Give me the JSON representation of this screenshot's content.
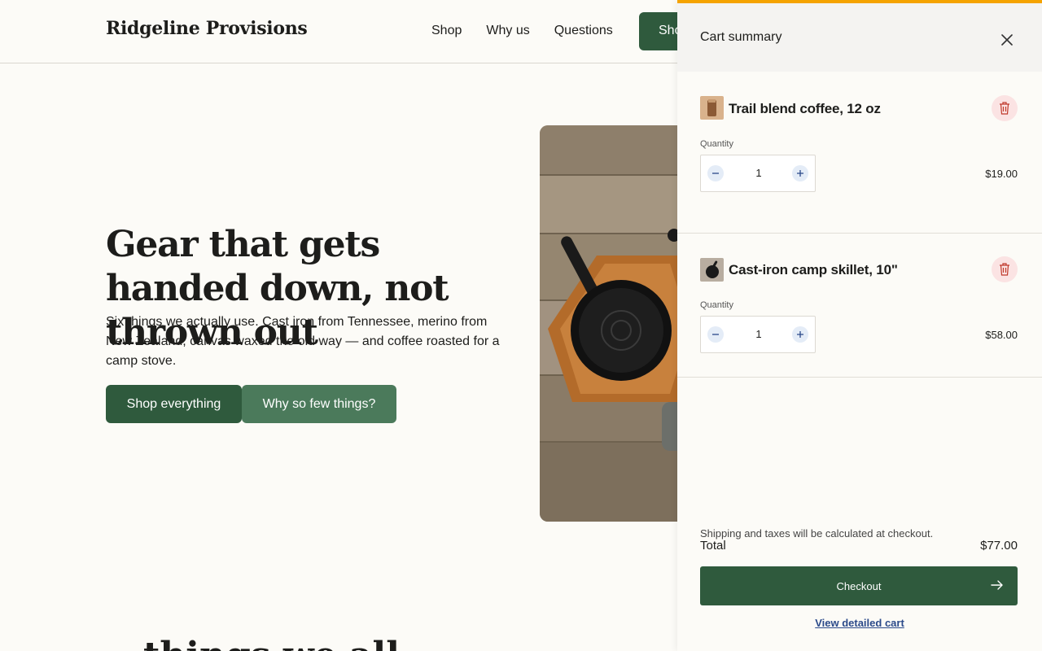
{
  "header": {
    "brand": "Ridgeline Provisions",
    "nav": [
      "Shop",
      "Why us",
      "Questions"
    ],
    "cta_label": "Shop"
  },
  "hero": {
    "title": "Gear that gets handed down, not thrown out",
    "subtitle": "Six things we actually use. Cast iron from Tennessee, merino from New Zealand, canvas waxed the old way — and coffee roasted for a camp stove.",
    "primary_button": "Shop everything",
    "secondary_button": "Why so few things?"
  },
  "next_section_peek": "...things we all...",
  "cart": {
    "title": "Cart summary",
    "quantity_label": "Quantity",
    "items": [
      {
        "name": "Trail blend coffee, 12 oz",
        "quantity": "1",
        "price": "$19.00"
      },
      {
        "name": "Cast-iron camp skillet, 10\"",
        "quantity": "1",
        "price": "$58.00"
      }
    ],
    "shipping_note": "Shipping and taxes will be calculated at checkout.",
    "total_label": "Total",
    "total_value": "$77.00",
    "checkout_label": "Checkout",
    "view_cart_label": "View detailed cart"
  },
  "colors": {
    "brand_green": "#2f5a3d",
    "secondary_green": "#4b7a5b",
    "accent_orange": "#f5a300",
    "trash_bg": "#fbe3e3",
    "link_blue": "#2b4a8a"
  }
}
